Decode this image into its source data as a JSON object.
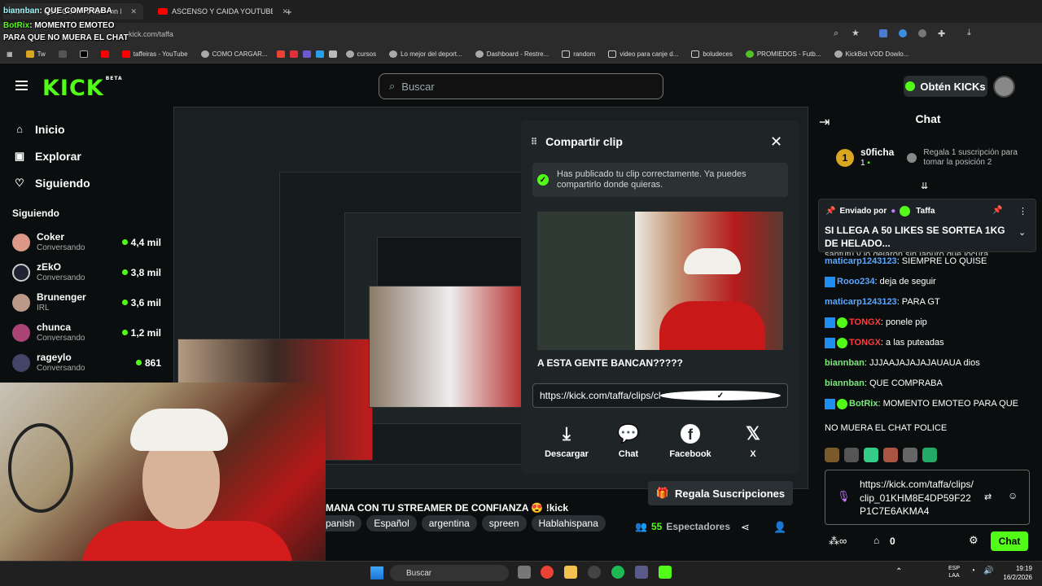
{
  "browser": {
    "tabs": [
      {
        "title": "biannban: QUE COMPRABA - on Kick"
      },
      {
        "title": "ASCENSO Y CAIDA YOUTUBE A"
      }
    ],
    "new_tab": "+",
    "address": "kick.com/taffa",
    "bookmarks": [
      "Tw",
      "",
      "",
      "",
      "taffeiras - YouTube",
      "COMO CARGAR...",
      "",
      "",
      "",
      "",
      "",
      "cursos",
      "Lo mejor del deport...",
      "Dashboard - Restre...",
      "random",
      "video para canje d...",
      "boludeces",
      "PROMIEDOS - Futb...",
      "KickBot VOD Dowlo..."
    ]
  },
  "overlay": {
    "line1_user": "biannban",
    "line1_text": ": QUE COMPRABA",
    "line2_user": "BotRix",
    "line2_text": ": MOMENTO EMOTEO",
    "line3_text": "PARA QUE NO MUERA EL CHAT"
  },
  "header": {
    "logo": "KICK",
    "logo_badge": "BETA",
    "search_placeholder": "Buscar",
    "kicks_button": "Obtén KICKs"
  },
  "sidebar": {
    "nav": [
      {
        "label": "Inicio",
        "icon": "home-icon"
      },
      {
        "label": "Explorar",
        "icon": "compass-icon"
      },
      {
        "label": "Siguiendo",
        "icon": "heart-icon"
      }
    ],
    "section_title": "Siguiendo",
    "channels": [
      {
        "name": "Coker",
        "sub": "Conversando",
        "count": "4,4 mil"
      },
      {
        "name": "zEkO",
        "sub": "Conversando",
        "count": "3,8 mil"
      },
      {
        "name": "Brunenger",
        "sub": "IRL",
        "count": "3,6 mil"
      },
      {
        "name": "chunca",
        "sub": "Conversando",
        "count": "1,2 mil"
      },
      {
        "name": "rageylo",
        "sub": "Conversando",
        "count": "861"
      }
    ]
  },
  "modal": {
    "title": "Compartir clip",
    "success": "Has publicado tu clip correctamente. Ya puedes compartirlo donde quieras.",
    "clip_title": "A ESTA GENTE BANCAN?????",
    "url": "https://kick.com/taffa/clips/clip_01KHM8E4DP59F2",
    "actions": [
      {
        "label": "Descargar",
        "icon": "download-icon"
      },
      {
        "label": "Chat",
        "icon": "chat-bubble-icon"
      },
      {
        "label": "Facebook",
        "icon": "facebook-icon"
      },
      {
        "label": "X",
        "icon": "x-logo-icon"
      }
    ]
  },
  "stream": {
    "title": "MANA CON TU STREAMER DE CONFIANZA 😍 !kick",
    "tags": [
      "panish",
      "Español",
      "argentina",
      "spreen",
      "Hablahispana"
    ],
    "gift_button": "Regala Suscripciones",
    "viewers_count": "55",
    "viewers_label": "Espectadores"
  },
  "chat": {
    "title": "Chat",
    "leader": {
      "rank": "1",
      "name": "s0ficha",
      "value": "1",
      "prompt": "Regala 1 suscripción para tomar la posición 2"
    },
    "pinned": {
      "label": "Enviado por",
      "user": "Taffa",
      "message": "SI LLEGA A 50 LIKES SE SORTEA 1KG DE HELADO..."
    },
    "partial_line": "santutu y lo dejaron sin laburo que locura",
    "messages": [
      {
        "user": "maticarp1243123",
        "text": ": SIEMPRE LO QUISE",
        "color": "#5aa7ff",
        "badges": ""
      },
      {
        "user": "Rooo234",
        "text": ": deja de seguir",
        "color": "#5aa7ff",
        "badges": "bot"
      },
      {
        "user": "maticarp1243123",
        "text": ": PARA GT",
        "color": "#5aa7ff",
        "badges": ""
      },
      {
        "user": "TONGX",
        "text": ": ponele pip",
        "color": "#ff3b3b",
        "badges": "bot-verif"
      },
      {
        "user": "TONGX",
        "text": ": a las puteadas",
        "color": "#ff3b3b",
        "badges": "bot-verif"
      },
      {
        "user": "biannban",
        "text": ": JJJAAJAJAJAJAUAUA dios",
        "color": "#7de87d",
        "badges": ""
      },
      {
        "user": "biannban",
        "text": ": QUE COMPRABA",
        "color": "#7de87d",
        "badges": ""
      },
      {
        "user": "BotRix",
        "text": ": MOMENTO EMOTEO PARA QUE",
        "color": "#7de87d",
        "badges": "bot-verif"
      }
    ],
    "wrap_line": "NO MUERA EL CHAT POLICE",
    "input_text": "https://kick.com/taffa/clips/clip_01KHM8E4DP59F22P1C7E6AKMA4",
    "points": "0",
    "send_button": "Chat"
  },
  "taskbar": {
    "search": "Buscar",
    "lang": "ESP",
    "lang2": "LAA",
    "time": "19:19",
    "date": "16/2/2026"
  }
}
